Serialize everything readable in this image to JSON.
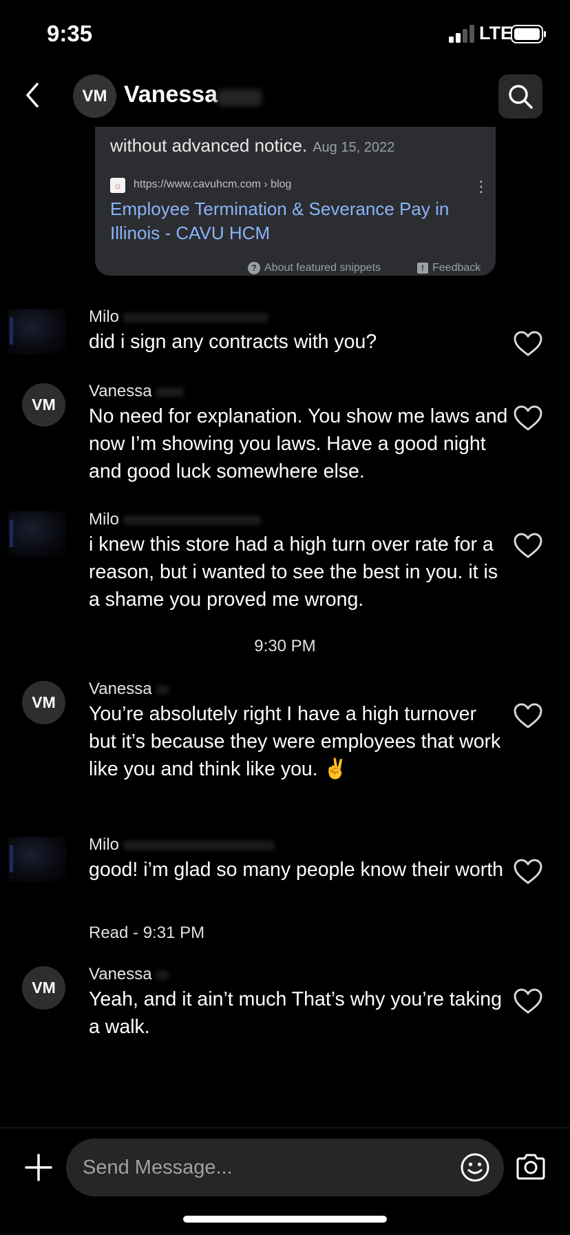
{
  "status_bar": {
    "time": "9:35",
    "network": "LTE"
  },
  "header": {
    "avatar_initials": "VM",
    "name": "Vanessa"
  },
  "snippet_card": {
    "text": "without advanced notice.",
    "date": "Aug 15, 2022",
    "url": "https://www.cavuhcm.com › blog",
    "link_title": "Employee Termination & Severance Pay in Illinois - CAVU HCM",
    "about_label": "About featured snippets",
    "feedback_label": "Feedback"
  },
  "messages": [
    {
      "sender": "Milo",
      "text": "did i sign any contracts with you?"
    },
    {
      "sender": "Vanessa",
      "avatar_initials": "VM",
      "text": "No need for explanation. You show me laws and now I’m showing you laws. Have a good night and good luck somewhere else."
    },
    {
      "sender": "Milo",
      "text": "i knew this store had a high turn over rate for a reason, but i wanted to see the best in you. it is a shame you proved me wrong."
    },
    {
      "sender": "Vanessa",
      "avatar_initials": "VM",
      "text": "You’re absolutely right I have a high turnover but it’s because they were employees that work like you and think like you. ✌️"
    },
    {
      "sender": "Milo",
      "text": "good! i’m glad so many people know their worth"
    },
    {
      "sender": "Vanessa",
      "avatar_initials": "VM",
      "text": "Yeah, and it ain’t much That’s why you’re taking a walk."
    }
  ],
  "timestamp": "9:30 PM",
  "read_receipt": "Read - 9:31 PM",
  "composer": {
    "placeholder": "Send Message..."
  },
  "icons": {
    "back": "chevron-left-icon",
    "search": "search-icon",
    "like": "heart-icon",
    "add": "plus-icon",
    "emoji": "smiley-icon",
    "camera": "camera-icon"
  },
  "colors": {
    "background": "#000000",
    "card": "#2c2d31",
    "link": "#8ab4f8",
    "bubble": "#262626"
  }
}
